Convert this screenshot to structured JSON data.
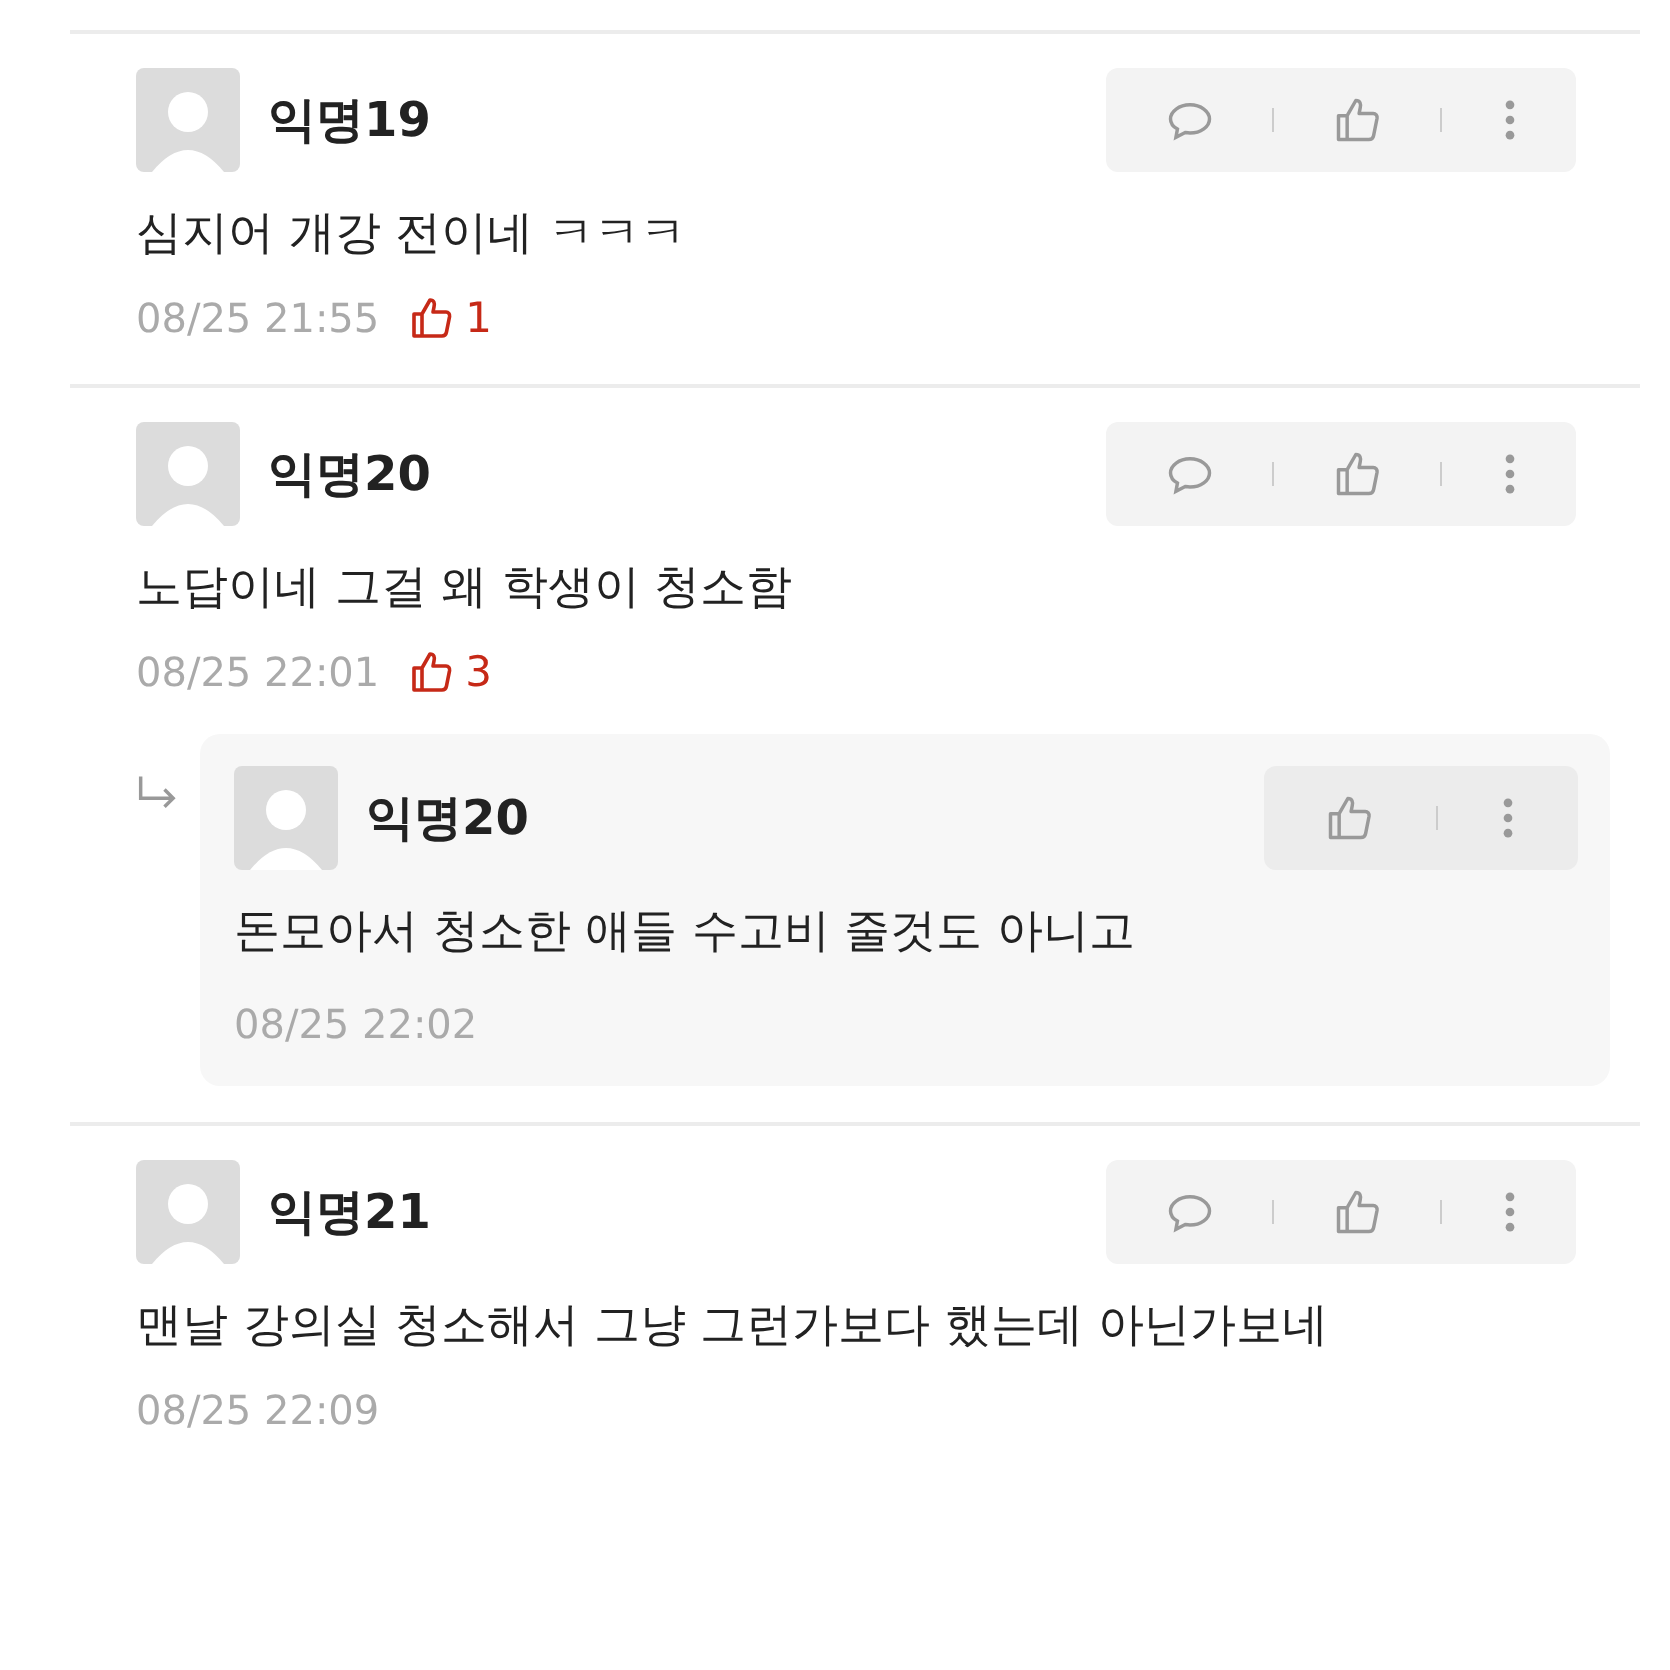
{
  "comments": [
    {
      "author": "익명19",
      "text": "심지어 개강 전이네 ㅋㅋㅋ",
      "time": "08/25 21:55",
      "votes": "1",
      "reply_button": true
    },
    {
      "author": "익명20",
      "text": "노답이네 그걸 왜 학생이 청소함",
      "time": "08/25 22:01",
      "votes": "3",
      "reply_button": true,
      "replies": [
        {
          "author": "익명20",
          "text": "돈모아서 청소한 애들 수고비 줄것도 아니고",
          "time": "08/25 22:02",
          "reply_button": false
        }
      ]
    },
    {
      "author": "익명21",
      "text": "맨날 강의실 청소해서 그냥 그런가보다 했는데 아닌가보네",
      "time": "08/25 22:09",
      "reply_button": true
    }
  ]
}
